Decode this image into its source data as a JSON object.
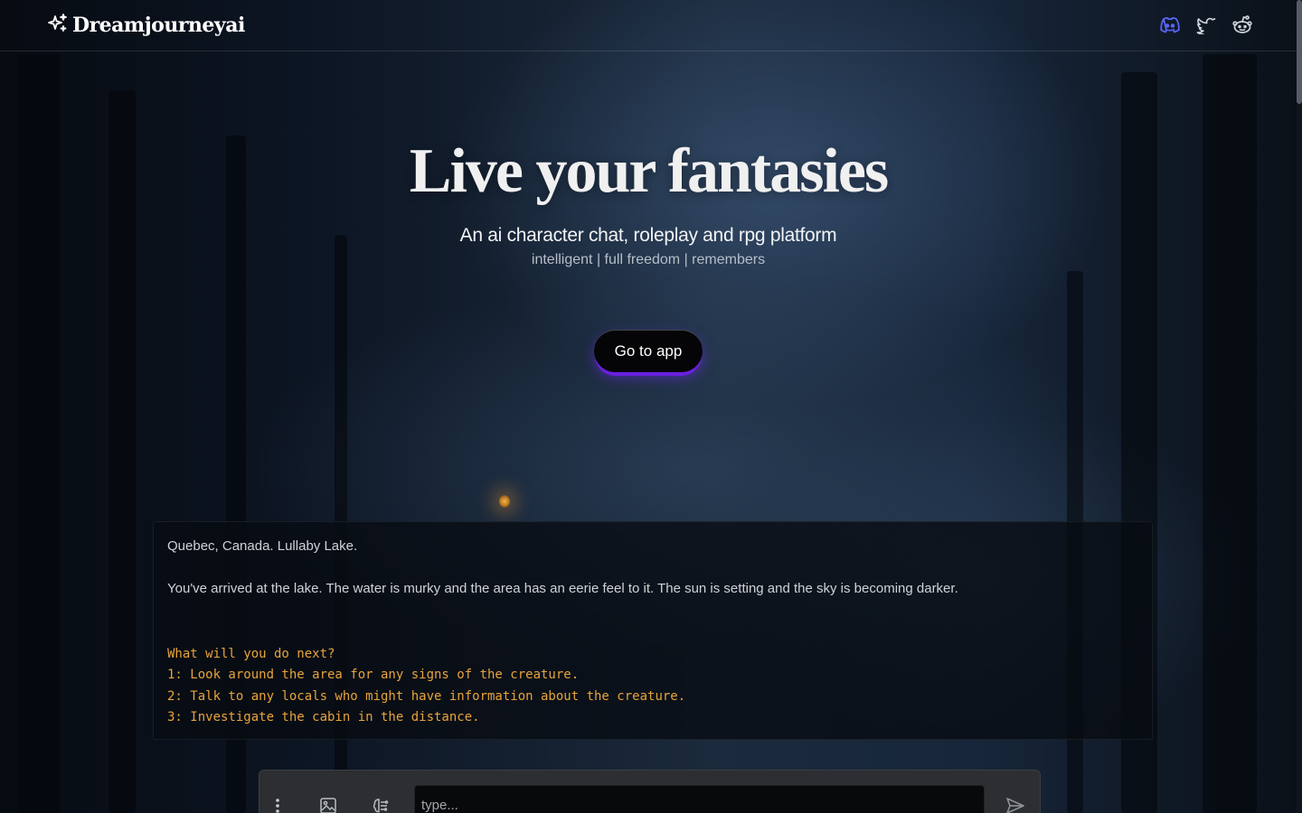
{
  "brand": {
    "name": "Dreamjourneyai",
    "icon": "sparkles-icon"
  },
  "header": {
    "socials": [
      {
        "name": "discord-icon",
        "color": "#5865F2"
      },
      {
        "name": "twitter-icon",
        "color": "#d0d4da"
      },
      {
        "name": "reddit-icon",
        "color": "#d0d4da"
      }
    ]
  },
  "hero": {
    "title": "Live your fantasies",
    "subtitle": "An ai character chat, roleplay and rpg platform",
    "tags": "intelligent | full freedom | remembers",
    "cta_label": "Go to app"
  },
  "chat": {
    "location": "Quebec, Canada. Lullaby Lake.",
    "description": "You've arrived at the lake. The water is murky and the area has an eerie feel to it. The sun is setting and the sky is becoming darker.",
    "prompt": "What will you do next?",
    "options": [
      "1: Look around the area for any signs of the creature.",
      "2: Talk to any locals who might have information about the creature.",
      "3: Investigate the cabin in the distance."
    ]
  },
  "input": {
    "placeholder": "type...",
    "tools": [
      "more-vertical-icon",
      "image-icon",
      "brain-icon",
      "send-icon"
    ]
  },
  "colors": {
    "accent": "#6a1fe0",
    "option_text": "#e7a43a",
    "background": "#0a0f18"
  }
}
